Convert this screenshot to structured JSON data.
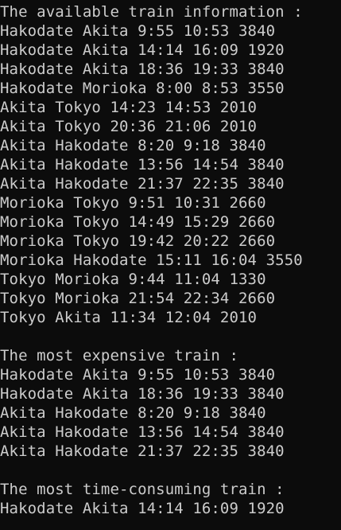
{
  "colors": {
    "background": "#0c0c0c",
    "text": "#cccccc"
  },
  "sections": {
    "available": {
      "heading": "The available train information :",
      "rows": [
        "Hakodate Akita 9:55 10:53 3840",
        "Hakodate Akita 14:14 16:09 1920",
        "Hakodate Akita 18:36 19:33 3840",
        "Hakodate Morioka 8:00 8:53 3550",
        "Akita Tokyo 14:23 14:53 2010",
        "Akita Tokyo 20:36 21:06 2010",
        "Akita Hakodate 8:20 9:18 3840",
        "Akita Hakodate 13:56 14:54 3840",
        "Akita Hakodate 21:37 22:35 3840",
        "Morioka Tokyo 9:51 10:31 2660",
        "Morioka Tokyo 14:49 15:29 2660",
        "Morioka Tokyo 19:42 20:22 2660",
        "Morioka Hakodate 15:11 16:04 3550",
        "Tokyo Morioka 9:44 11:04 1330",
        "Tokyo Morioka 21:54 22:34 2660",
        "Tokyo Akita 11:34 12:04 2010"
      ]
    },
    "expensive": {
      "heading": "The most expensive train :",
      "rows": [
        "Hakodate Akita 9:55 10:53 3840",
        "Hakodate Akita 18:36 19:33 3840",
        "Akita Hakodate 8:20 9:18 3840",
        "Akita Hakodate 13:56 14:54 3840",
        "Akita Hakodate 21:37 22:35 3840"
      ]
    },
    "time_consuming": {
      "heading": "The most time-consuming train :",
      "rows": [
        "Hakodate Akita 14:14 16:09 1920"
      ]
    }
  }
}
